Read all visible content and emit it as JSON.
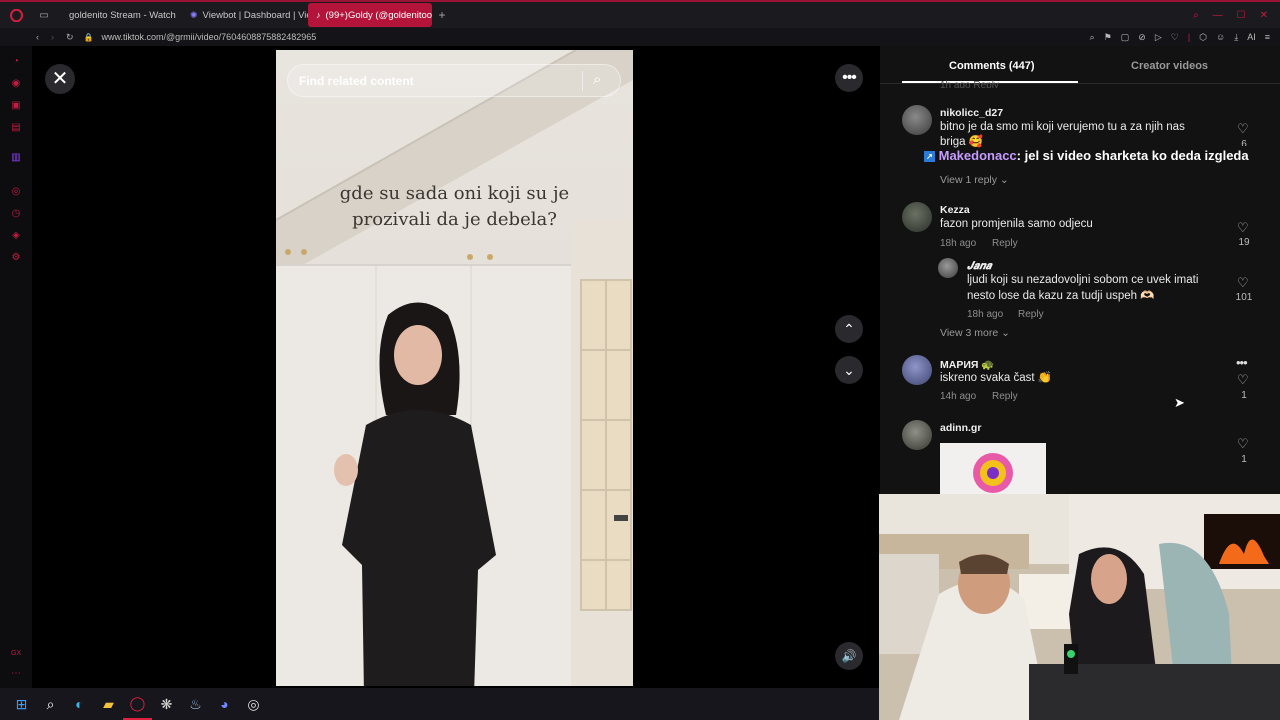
{
  "browser": {
    "tabs": [
      {
        "label": "goldenito Stream - Watch",
        "icon_color": "#53fc18"
      },
      {
        "label": "Viewbot | Dashboard | Vie",
        "icon_color": "#8a7cff"
      },
      {
        "label": "(99+)Goldy (@goldenitoo)",
        "icon_color": "#ffffff",
        "active": true
      }
    ],
    "url": "www.tiktok.com/@grmii/video/7604608875882482965",
    "ai_label": "AI"
  },
  "video": {
    "search_placeholder": "Find related content",
    "caption_line1": "gde su sada oni koji su je",
    "caption_line2": "prozivali da je debela?"
  },
  "panel": {
    "tab_comments": "Comments (447)",
    "tab_creator": "Creator videos",
    "top_partial_meta": "1h ago   Reply",
    "comments": [
      {
        "user": "nikolicc_d27",
        "text1": "bitno je da smo mi koji verujemo tu a za njih nas",
        "text2": "briga 🥰",
        "likes": "6",
        "view_replies": "View 1 reply"
      },
      {
        "user": "Kezza",
        "text1": "fazon promjenila samo odjecu",
        "time": "18h ago",
        "reply": "Reply",
        "likes": "19"
      },
      {
        "user": "𝑱𝒂𝒏𝒂",
        "text1": "ljudi koji su nezadovoljni sobom ce uvek imati",
        "text2": "nesto lose da kazu za tudji uspeh 🫶🏻",
        "time": "18h ago",
        "reply": "Reply",
        "likes": "101",
        "view_more": "View 3 more"
      },
      {
        "user": "МАРИЯ 🐢",
        "text1": "iskreno svaka čast 👏",
        "time": "14h ago",
        "reply": "Reply",
        "likes": "1"
      },
      {
        "user": "adinn.gr",
        "likes": "1"
      }
    ],
    "chat_overlay": {
      "name": "Makedonacc",
      "message": ": jel si video sharketa ko deda izgleda"
    }
  },
  "colors": {
    "accent": "#b4143a",
    "chat_name": "#c69cff"
  }
}
